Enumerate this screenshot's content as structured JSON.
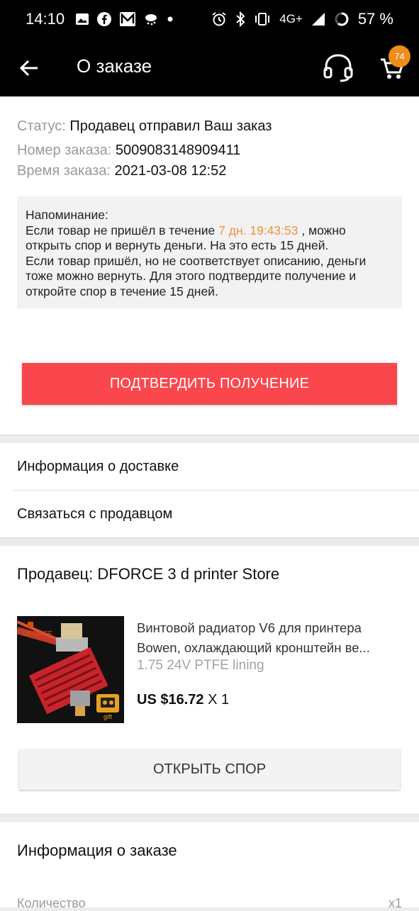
{
  "status_bar": {
    "time": "14:10",
    "network": "4G+",
    "battery": "57 %",
    "icons_left": [
      "image-icon",
      "facebook-icon",
      "m-app-icon",
      "weather-icon",
      "dot-icon"
    ],
    "icons_right": [
      "alarm-icon",
      "bluetooth-icon",
      "vibrate-icon",
      "signal-icon",
      "battery-icon"
    ]
  },
  "header": {
    "title": "О заказе",
    "cart_count": "74"
  },
  "order": {
    "status_label": "Статус:",
    "status_value": "Продавец отправил Ваш заказ",
    "number_label": "Номер заказа:",
    "number_value": "5009083148909411",
    "time_label": "Время заказа:",
    "time_value": "2021-03-08 12:52"
  },
  "reminder": {
    "title": "Напоминание:",
    "line1_before": "Если товар не пришёл в течение ",
    "countdown": "7 дн. 19:43:53",
    "line1_after": " , можно открыть спор и вернуть деньги. На это есть 15 дней.",
    "line2": "Если товар пришёл, но не соответствует описанию, деньги тоже можно вернуть. Для этого подтвердите получение и откройте спор в течение 15 дней."
  },
  "confirm_button": "ПОДТВЕРДИТЬ ПОЛУЧЕНИЕ",
  "menu": {
    "delivery": "Информация о доставке",
    "contact": "Связаться с продавцом"
  },
  "seller": {
    "title": "Продавец: DFORCE 3 d printer Store"
  },
  "product": {
    "name_line1": "Винтовой радиатор V6 для принтера",
    "name_line2": "Bowen, охлаждающий кронштейн ве...",
    "variant": "1.75 24V PTFE lining",
    "price": "US $16.72",
    "quantity": "X 1",
    "image_brand": "DFORCE",
    "image_gift": "gift"
  },
  "dispute_button": "ОТКРЫТЬ СПОР",
  "order_info": {
    "title": "Информация о заказе",
    "qty_label": "Количество",
    "qty_value": "x1"
  },
  "colors": {
    "accent_red": "#f9474d",
    "badge_orange": "#f08c1a",
    "countdown_orange": "#f0913a"
  }
}
